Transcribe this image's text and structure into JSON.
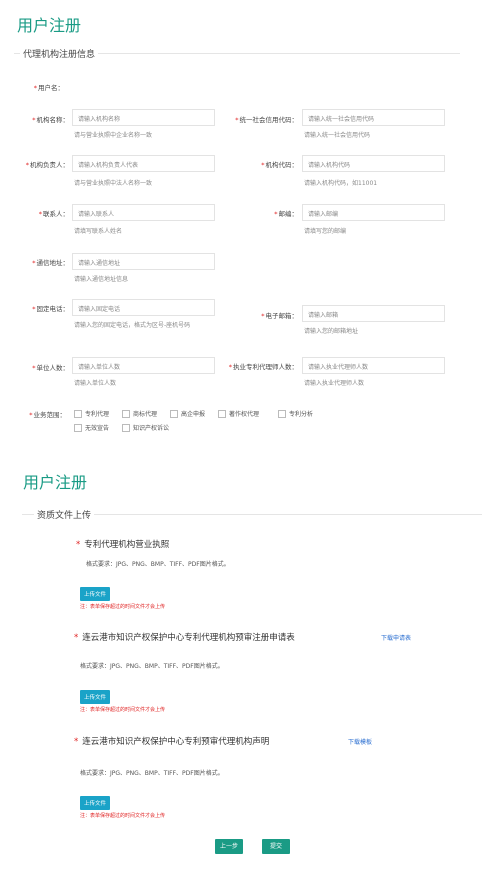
{
  "header": {
    "title": "用户注册"
  },
  "section1": {
    "title": "代理机构注册信息"
  },
  "form": {
    "username": {
      "label": "用户名："
    },
    "org_name": {
      "label": "机构名称：",
      "placeholder": "请输入机构名称",
      "hint": "请与营业执照中企业名称一致"
    },
    "credit_code": {
      "label": "统一社会信用代码：",
      "placeholder": "请输入统一社会信用代码",
      "hint": "请输入统一社会信用代码"
    },
    "legal_rep": {
      "label": "机构负责人：",
      "placeholder": "请输入机构负责人代表",
      "hint": "请与营业执照中法人名称一致"
    },
    "org_code": {
      "label": "机构代码：",
      "placeholder": "请输入机构代码",
      "hint": "请输入机构代码，如11001"
    },
    "contact": {
      "label": "联系人：",
      "placeholder": "请输入联系人",
      "hint": "请填写联系人姓名"
    },
    "postcode": {
      "label": "邮编：",
      "placeholder": "请输入邮编",
      "hint": "请填写您的邮编"
    },
    "address": {
      "label": "通信地址：",
      "placeholder": "请输入通信地址",
      "hint": "请输入通信地址信息"
    },
    "phone": {
      "label": "固定电话：",
      "placeholder": "请输入固定电话",
      "hint": "请输入您的固定电话，格式为区号-座机号码"
    },
    "email": {
      "label": "电子邮箱：",
      "placeholder": "请输入邮箱",
      "hint": "请输入您的邮箱地址"
    },
    "staff_count": {
      "label": "单位人数：",
      "placeholder": "请输入单位人数",
      "hint": "请输入单位人数"
    },
    "agent_count": {
      "label": "执业专利代理师人数：",
      "placeholder": "请输入执业代理师人数",
      "hint": "请输入执业代理师人数"
    },
    "scope": {
      "label": "业务范围：",
      "options": [
        "专利代理",
        "商标代理",
        "高企申报",
        "著作权代理",
        "专利分析",
        "无效宣告",
        "知识产权诉讼"
      ]
    }
  },
  "header2": {
    "title": "用户注册"
  },
  "section2": {
    "title": "资质文件上传"
  },
  "uploads": [
    {
      "title": "专利代理机构营业执照",
      "format": "格式要求：JPG、PNG、BMP、TIFF、PDF图片格式。",
      "button": "上传文件",
      "note": "注：表单保存超过的时间文件才会上传",
      "link": ""
    },
    {
      "title": "连云港市知识产权保护中心专利代理机构预审注册申请表",
      "format": "格式要求：JPG、PNG、BMP、TIFF、PDF图片格式。",
      "button": "上传文件",
      "note": "注：表单保存超过的时间文件才会上传",
      "link": "下载申请表"
    },
    {
      "title": "连云港市知识产权保护中心专利预审代理机构声明",
      "format": "格式要求：JPG、PNG、BMP、TIFF、PDF图片格式。",
      "button": "上传文件",
      "note": "注：表单保存超过的时间文件才会上传",
      "link": "下载模板"
    }
  ],
  "actions": {
    "prev": "上一步",
    "submit": "提交"
  },
  "colors": {
    "accent": "#1a9b85",
    "upload": "#1aa3c8",
    "required": "#e02424",
    "link": "#2b6fd1"
  }
}
